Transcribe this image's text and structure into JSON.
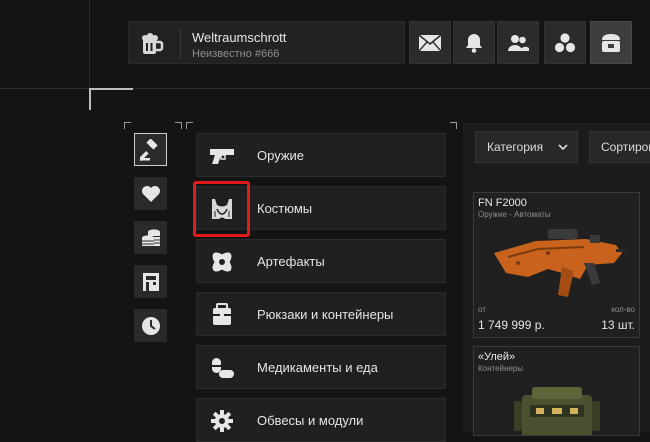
{
  "user": {
    "name": "Weltraumschrott",
    "subtitle": "Неизвестно #666"
  },
  "top_icons": [
    "mail-icon",
    "bell-icon",
    "users-icon",
    "circles-icon",
    "shop-icon"
  ],
  "side_icons": [
    "gavel-icon",
    "heart-icon",
    "coins-icon",
    "building-icon",
    "clock-icon"
  ],
  "categories": [
    {
      "label": "Оружие",
      "icon": "pistol-icon"
    },
    {
      "label": "Костюмы",
      "icon": "armor-icon"
    },
    {
      "label": "Артефакты",
      "icon": "artifact-icon"
    },
    {
      "label": "Рюкзаки и контейнеры",
      "icon": "backpack-icon"
    },
    {
      "label": "Медикаменты и еда",
      "icon": "pills-icon"
    },
    {
      "label": "Обвесы и модули",
      "icon": "gear-icon"
    }
  ],
  "filters": {
    "category": "Категория",
    "sort": "Сортиров"
  },
  "listings": [
    {
      "title": "FN F2000",
      "subtitle": "Оружие - Автоматы",
      "price_label": "от",
      "price": "1 749 999 р.",
      "qty_label": "кол-во",
      "qty": "13 шт."
    },
    {
      "title": "«Улей»",
      "subtitle": "Контейнеры"
    }
  ],
  "colors": {
    "background": "#141414",
    "highlight": "#e11b1b",
    "rifle": "#c8621c"
  }
}
